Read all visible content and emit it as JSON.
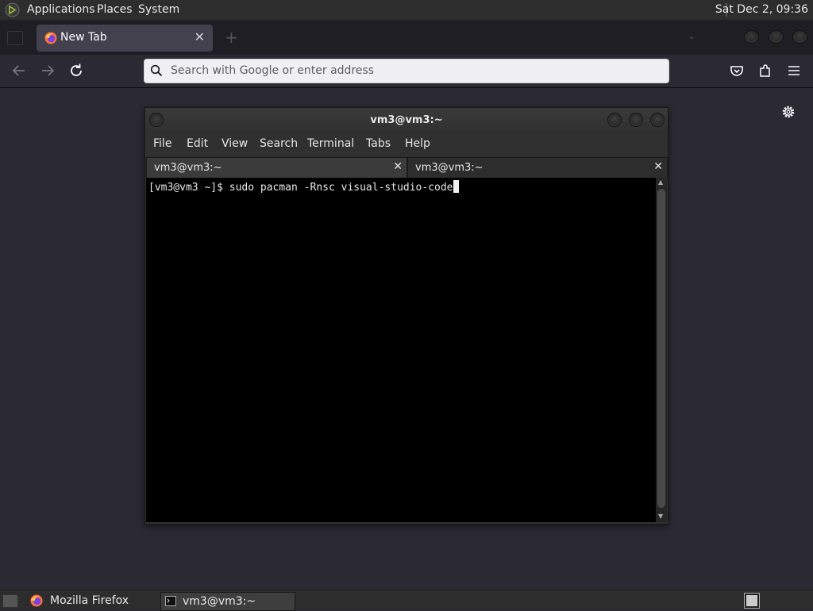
{
  "top_panel": {
    "menus": [
      "Applications",
      "Places",
      "System"
    ],
    "clock": "Sat Dec  2, 09:36"
  },
  "firefox": {
    "tab_title": "New Tab",
    "url_placeholder": "Search with Google or enter address"
  },
  "terminal": {
    "title": "vm3@vm3:~",
    "menu": [
      "File",
      "Edit",
      "View",
      "Search",
      "Terminal",
      "Tabs",
      "Help"
    ],
    "tabs": [
      "vm3@vm3:~",
      "vm3@vm3:~"
    ],
    "command_line": "[vm3@vm3 ~]$ sudo pacman -Rnsc visual-studio-code"
  },
  "taskbar": {
    "items": [
      "Mozilla Firefox",
      "vm3@vm3:~"
    ]
  }
}
